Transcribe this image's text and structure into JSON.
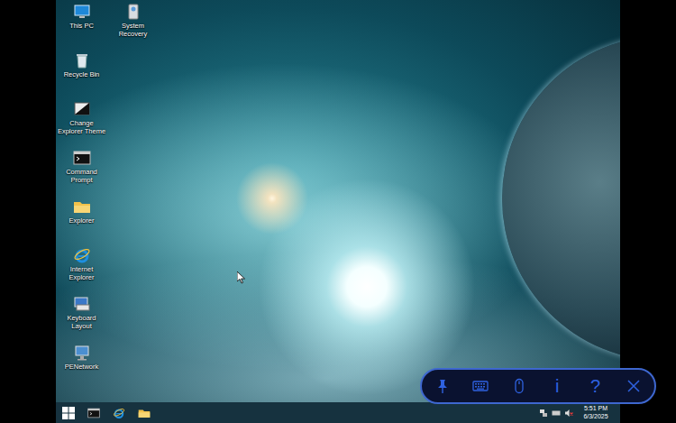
{
  "desktop": {
    "icons": [
      {
        "label": "This PC",
        "kind": "pc"
      },
      {
        "label": "Recycle Bin",
        "kind": "recycle"
      },
      {
        "label": "Change Explorer Theme",
        "kind": "theme"
      },
      {
        "label": "Command Prompt",
        "kind": "cmd"
      },
      {
        "label": "Explorer",
        "kind": "folder"
      },
      {
        "label": "Internet Explorer",
        "kind": "ie"
      },
      {
        "label": "Keyboard Layout",
        "kind": "keyboard"
      },
      {
        "label": "PENetwork",
        "kind": "network"
      },
      {
        "label": "System Recovery",
        "kind": "recovery"
      }
    ]
  },
  "taskbar": {
    "apps": [
      {
        "kind": "start"
      },
      {
        "kind": "cmd"
      },
      {
        "kind": "ie"
      },
      {
        "kind": "folder"
      }
    ],
    "tray": [
      {
        "kind": "network",
        "muted": false
      },
      {
        "kind": "keyboard",
        "muted": false
      },
      {
        "kind": "volume",
        "muted": true
      }
    ],
    "time": "5:51 PM",
    "date": "6/3/2025"
  },
  "toolbar": {
    "buttons": [
      {
        "kind": "pin"
      },
      {
        "kind": "keyboard"
      },
      {
        "kind": "mouse"
      },
      {
        "kind": "text",
        "text": "i"
      },
      {
        "kind": "text",
        "text": "?"
      },
      {
        "kind": "close"
      }
    ]
  }
}
